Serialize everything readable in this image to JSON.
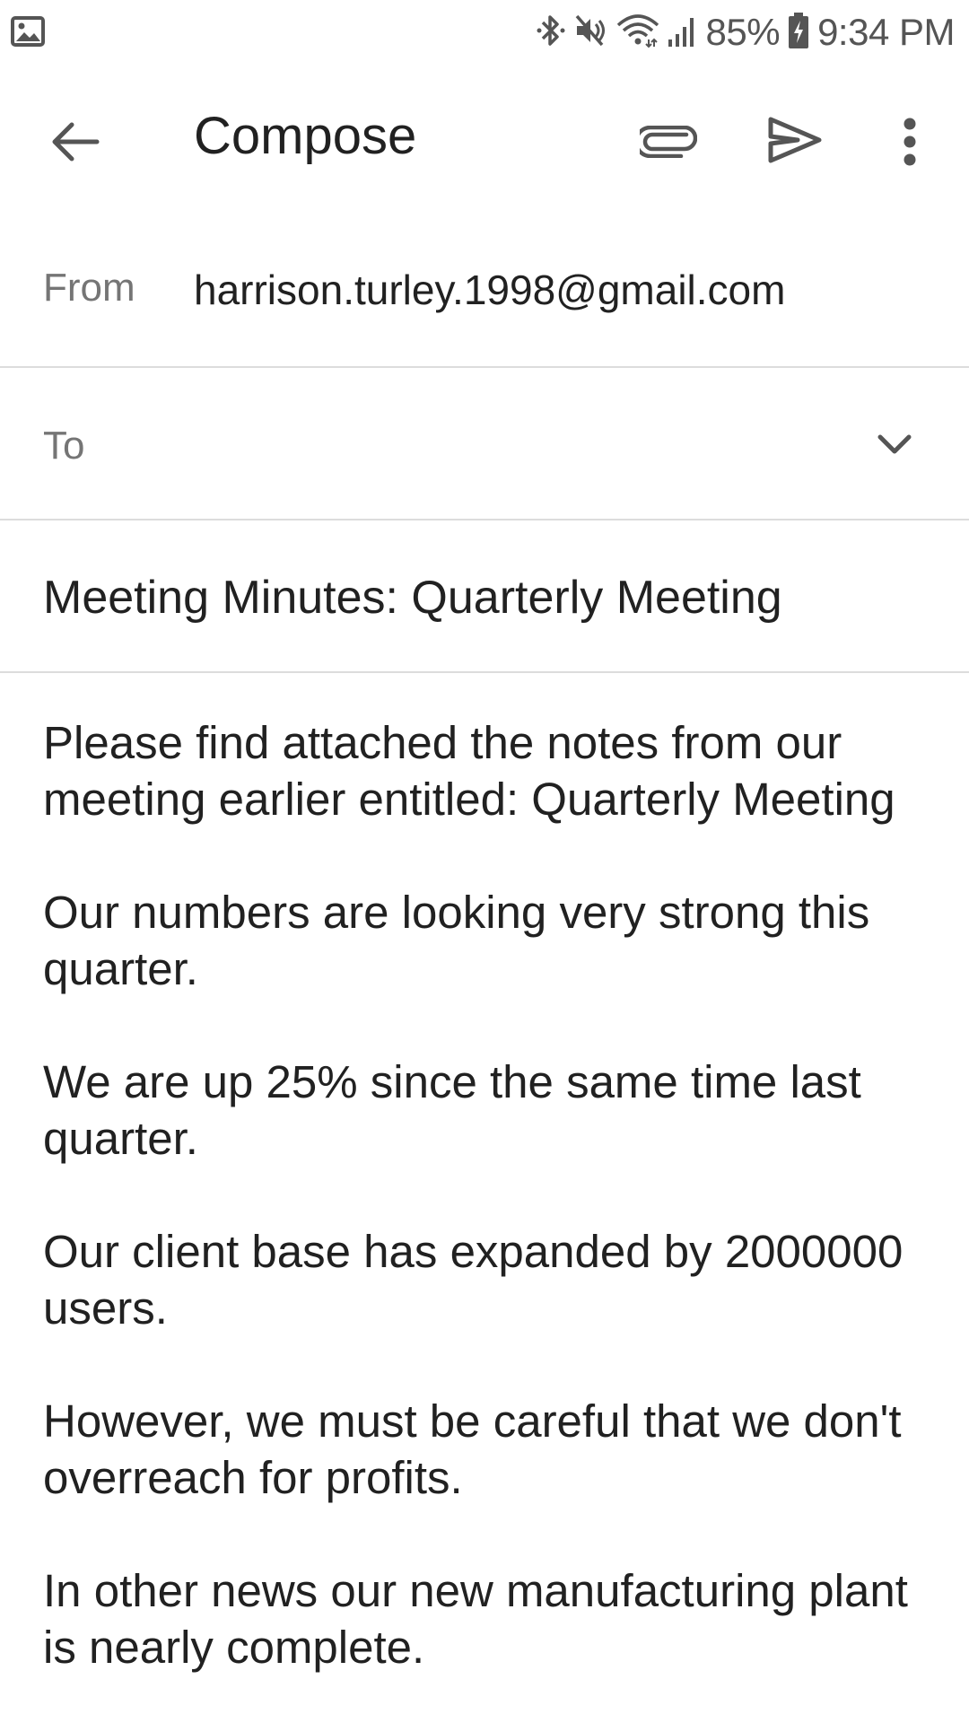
{
  "status_bar": {
    "battery": "85%",
    "time": "9:34 PM",
    "icons": [
      "image-notification-icon",
      "bluetooth-icon",
      "mute-icon",
      "wifi-icon",
      "signal-icon",
      "battery-icon"
    ]
  },
  "app_bar": {
    "title": "Compose",
    "icons": [
      "back-arrow-icon",
      "paperclip-icon",
      "send-icon",
      "more-vert-icon"
    ]
  },
  "from": {
    "label": "From",
    "value": "harrison.turley.1998@gmail.com"
  },
  "to": {
    "label": "To",
    "value": ""
  },
  "subject": {
    "value": "Meeting Minutes: Quarterly Meeting"
  },
  "body": {
    "paragraphs": [
      "Please find attached the notes from our meeting earlier entitled: Quarterly Meeting",
      "Our numbers are looking very strong this quarter.",
      "We are up 25% since the same time last quarter.",
      "Our client base has expanded by 2000000 users.",
      "However, we must be careful that we don't overreach for profits.",
      "In other news our new manufacturing plant is nearly complete."
    ]
  },
  "colors": {
    "text_primary": "#212121",
    "text_secondary": "#757575",
    "icon": "#555555",
    "divider": "#dcdcdc",
    "background": "#ffffff"
  }
}
